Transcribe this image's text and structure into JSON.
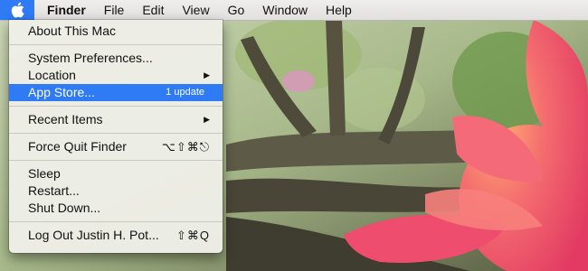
{
  "menubar": {
    "apple_icon": "apple-logo-icon",
    "items": [
      "Finder",
      "File",
      "Edit",
      "View",
      "Go",
      "Window",
      "Help"
    ]
  },
  "apple_menu": {
    "about": "About This Mac",
    "system_prefs": "System Preferences...",
    "location": "Location",
    "app_store": "App Store...",
    "app_store_badge": "1 update",
    "recent_items": "Recent Items",
    "force_quit": "Force Quit Finder",
    "force_quit_shortcut": "⌥⇧⌘⎋",
    "sleep": "Sleep",
    "restart": "Restart...",
    "shut_down": "Shut Down...",
    "log_out": "Log Out Justin H. Pot...",
    "log_out_shortcut": "⇧⌘Q",
    "submenu_arrow": "▶"
  },
  "colors": {
    "highlight": "#2f7bf5",
    "flower": "#f0506e"
  }
}
